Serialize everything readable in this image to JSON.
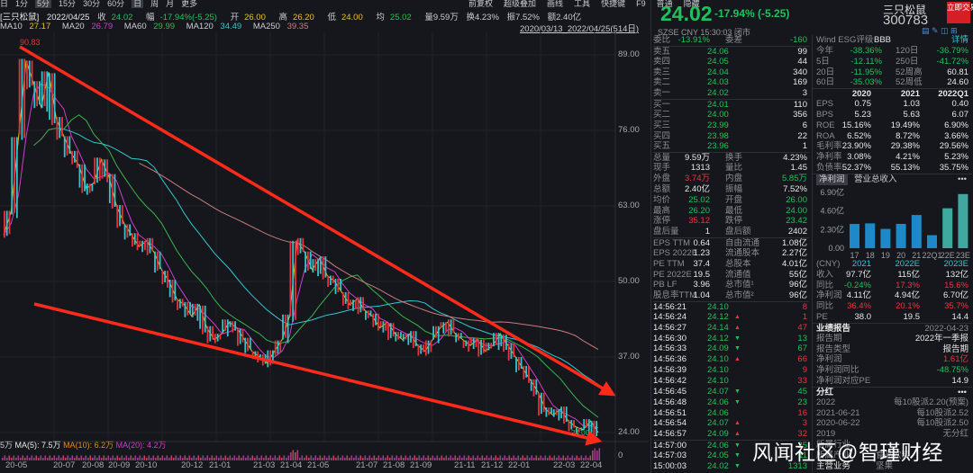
{
  "toolbar": {
    "left": [
      "日",
      "1分",
      "5分",
      "15分",
      "30分",
      "60分",
      "日",
      "周",
      "月",
      "更多"
    ],
    "right": [
      "前复权",
      "超级叠加",
      "画线",
      "工具",
      "快捷键",
      "F9",
      "普通",
      "隐藏"
    ]
  },
  "info": {
    "name": "[三只松鼠]",
    "date": "2022/04/25",
    "close_l": "收",
    "close": "24.02",
    "chg_l": "幅",
    "chg": "-17.94%(-5.25)",
    "open_l": "开",
    "open": "26.00",
    "high_l": "高",
    "high": "26.20",
    "low_l": "低",
    "low": "24.00",
    "avg_l": "均",
    "avg": "25.02",
    "vol": "量9.59万",
    "turn": "换4.23%",
    "amp": "振7.52%",
    "amt": "额2.40亿"
  },
  "mas": [
    {
      "label": "MA10",
      "value": "27.17"
    },
    {
      "label": "MA20",
      "value": "26.79"
    },
    {
      "label": "MA60",
      "value": "29.99"
    },
    {
      "label": "MA120",
      "value": "34.49"
    },
    {
      "label": "MA250",
      "value": "39.35"
    }
  ],
  "range": "2020/03/13_2022/04/25(514日)",
  "chart_data": {
    "type": "candlestick",
    "ylim": [
      21,
      92
    ],
    "yticks": [
      "89.00",
      "76.00",
      "63.00",
      "50.00",
      "37.00",
      "24.00"
    ],
    "xticks": [
      "20-05",
      "20-07",
      "20-08",
      "20-09",
      "20-10",
      "20-12",
      "21-01",
      "21-03",
      "21-04",
      "21-05",
      "21-07",
      "21-08",
      "21-09",
      "21-11",
      "21-12",
      "22-01",
      "22-03",
      "22-04"
    ],
    "high_label": "90.83",
    "low_label": "24.00",
    "vol_zero": "0",
    "close_approx": [
      58,
      62,
      75,
      88,
      84,
      80,
      86,
      78,
      75,
      72,
      70,
      66,
      67,
      71,
      68,
      63,
      60,
      58,
      56,
      57,
      55,
      52,
      50,
      47,
      46,
      44,
      46,
      42,
      40,
      41,
      43,
      42,
      40,
      38,
      37,
      36,
      38,
      40,
      44,
      57,
      55,
      52,
      54,
      51,
      50,
      48,
      46,
      47,
      45,
      44,
      42,
      43,
      41,
      40,
      41,
      39,
      38,
      40,
      42,
      43,
      41,
      40,
      39,
      40,
      38,
      39,
      41,
      39,
      37,
      35,
      33,
      31,
      28,
      27,
      28,
      26,
      25,
      24.5,
      26,
      24
    ]
  },
  "volinfo": {
    "prefix": "5万",
    "ma5": "MA(5): 7.5万",
    "ma10": "MA(10): 6.2万",
    "ma20": "MA(20): 4.2万"
  },
  "quote": {
    "price": "24.02",
    "change": "-17.94% (-5.25)",
    "name": "三只松鼠",
    "code": "300783",
    "trade": "立即交易",
    "market": "SZSE   CNY   15:30:03  闭市"
  },
  "left_rows": [
    [
      "委比",
      "-13.91%",
      "委差",
      "-160"
    ],
    [
      "卖五",
      "24.06",
      "",
      "99"
    ],
    [
      "卖四",
      "24.05",
      "",
      "44"
    ],
    [
      "卖三",
      "24.04",
      "",
      "340"
    ],
    [
      "卖二",
      "24.03",
      "",
      "169"
    ],
    [
      "卖一",
      "24.02",
      "",
      "3"
    ],
    [
      "买一",
      "24.01",
      "",
      "110"
    ],
    [
      "买二",
      "24.00",
      "",
      "356"
    ],
    [
      "买三",
      "23.99",
      "",
      "6"
    ],
    [
      "买四",
      "23.98",
      "",
      "22"
    ],
    [
      "买五",
      "23.96",
      "",
      "1"
    ],
    [
      "总量",
      "9.59万",
      "换手",
      "4.23%"
    ],
    [
      "现手",
      "1313",
      "量比",
      "1.45"
    ],
    [
      "外盘",
      "3.74万",
      "内盘",
      "5.85万"
    ],
    [
      "总额",
      "2.40亿",
      "振幅",
      "7.52%"
    ],
    [
      "均价",
      "25.02",
      "开盘",
      "26.00"
    ],
    [
      "最高",
      "26.20",
      "最低",
      "24.00"
    ],
    [
      "涨停",
      "35.12",
      "跌停",
      "23.42"
    ],
    [
      "盘后量",
      "1",
      "盘后额",
      "2402"
    ],
    [
      "EPS TTM",
      "0.64",
      "自由流通",
      "1.08亿"
    ],
    [
      "EPS 2022E",
      "1.23",
      "流通股本",
      "2.27亿"
    ],
    [
      "PE TTM",
      "37.4",
      "总股本",
      "4.01亿"
    ],
    [
      "PE 2022E",
      "19.5",
      "流通值",
      "55亿"
    ],
    [
      "PB LF",
      "3.96",
      "总市值¹",
      "96亿"
    ],
    [
      "股息率TTM",
      "1.04",
      "总市值²",
      "96亿"
    ]
  ],
  "trades": [
    [
      "14:56:21",
      "24.10",
      "",
      "8"
    ],
    [
      "14:56:24",
      "24.12",
      "up",
      "1"
    ],
    [
      "14:56:27",
      "24.14",
      "up",
      "47"
    ],
    [
      "14:56:30",
      "24.12",
      "down",
      "13"
    ],
    [
      "14:56:33",
      "24.09",
      "down",
      "67"
    ],
    [
      "14:56:36",
      "24.10",
      "up",
      "66"
    ],
    [
      "14:56:39",
      "24.10",
      "",
      "9"
    ],
    [
      "14:56:42",
      "24.10",
      "",
      "33"
    ],
    [
      "14:56:45",
      "24.07",
      "down",
      "45"
    ],
    [
      "14:56:48",
      "24.06",
      "down",
      "23"
    ],
    [
      "14:56:51",
      "24.06",
      "",
      "16"
    ],
    [
      "14:56:54",
      "24.07",
      "up",
      "3"
    ],
    [
      "14:56:57",
      "24.09",
      "up",
      "32"
    ],
    [
      "14:57:00",
      "24.06",
      "down",
      "25"
    ],
    [
      "14:57:03",
      "24.05",
      "down",
      "11"
    ],
    [
      "15:00:03",
      "24.02",
      "down",
      "1313"
    ]
  ],
  "right_top": {
    "esg_l": "Wind ESG评级",
    "esg": "BBB",
    "detail": "详情",
    "perf": [
      [
        "今年",
        "-38.36%",
        "120日",
        "-36.79%"
      ],
      [
        "5日",
        "-12.11%",
        "250日",
        "-41.72%"
      ],
      [
        "20日",
        "-11.95%",
        "52周高",
        "60.81"
      ],
      [
        "60日",
        "-35.03%",
        "52周低",
        "24.60"
      ]
    ]
  },
  "fin": {
    "years": [
      "2020",
      "2021",
      "2022Q1"
    ],
    "rows": [
      [
        "EPS",
        "0.75",
        "1.03",
        "0.40"
      ],
      [
        "BPS",
        "5.23",
        "5.63",
        "6.07"
      ],
      [
        "ROE",
        "15.16%",
        "19.49%",
        "6.90%"
      ],
      [
        "ROA",
        "6.52%",
        "8.72%",
        "3.66%"
      ],
      [
        "毛利率",
        "23.90%",
        "29.38%",
        "29.56%"
      ],
      [
        "净利率",
        "3.08%",
        "4.21%",
        "5.23%"
      ],
      [
        "负债率",
        "52.37%",
        "55.13%",
        "35.75%"
      ]
    ]
  },
  "profit_chart": {
    "tabs": [
      "净利润",
      "营业总收入"
    ],
    "more": "•••",
    "yticks": [
      "6.90亿",
      "4.60亿",
      "2.30亿",
      "0.00"
    ],
    "categories": [
      "17",
      "18",
      "19",
      "20",
      "21",
      "22Q1",
      "22E",
      "23E"
    ],
    "values": [
      3.0,
      3.07,
      2.39,
      3.01,
      4.11,
      1.61,
      4.94,
      6.7
    ],
    "estimate": [
      false,
      false,
      false,
      false,
      false,
      false,
      true,
      true
    ],
    "ymax": 6.9,
    "colors": {
      "actual": "#1e88c8",
      "estimate": "#3fa9a0"
    }
  },
  "forecast": {
    "head": [
      "(CNY)",
      "2021",
      "2022E",
      "2023E"
    ],
    "rows": [
      [
        "收入",
        "97.7亿",
        "115亿",
        "132亿"
      ],
      [
        "同比",
        "-0.24%",
        "17.3%",
        "15.6%"
      ],
      [
        "净利润",
        "4.11亿",
        "4.94亿",
        "6.70亿"
      ],
      [
        "同比",
        "36.4%",
        "20.1%",
        "35.7%"
      ],
      [
        "PE",
        "38.0",
        "19.5",
        "14.4"
      ]
    ]
  },
  "report": {
    "title": "业绩报告",
    "date": "2022-04-23",
    "rows": [
      [
        "报告期",
        "2022年一季报"
      ],
      [
        "报告类型",
        "报告期"
      ],
      [
        "净利润",
        "1.61亿"
      ],
      [
        "净利润同比",
        "-48.75%"
      ],
      [
        "净利润对应PE",
        "14.9"
      ]
    ]
  },
  "dividend": {
    "title": "分红",
    "more": "•••",
    "rows": [
      [
        "2022",
        "每10股派2.20(预案)"
      ],
      [
        "2021-06-21",
        "每10股派2.52"
      ],
      [
        "2020-06-22",
        "每10股派2.50"
      ],
      [
        "2019",
        "无分红"
      ]
    ]
  },
  "industry": {
    "rows": [
      [
        "所属行业",
        ""
      ],
      [
        "所属产业",
        "食品饮料"
      ],
      [
        "主营业务",
        "坚果"
      ]
    ]
  },
  "watermark": "风闻社区@智瑾财经",
  "colors": {
    "up": "#ef3340",
    "down": "#1fc25a",
    "bg": "#16171c"
  }
}
